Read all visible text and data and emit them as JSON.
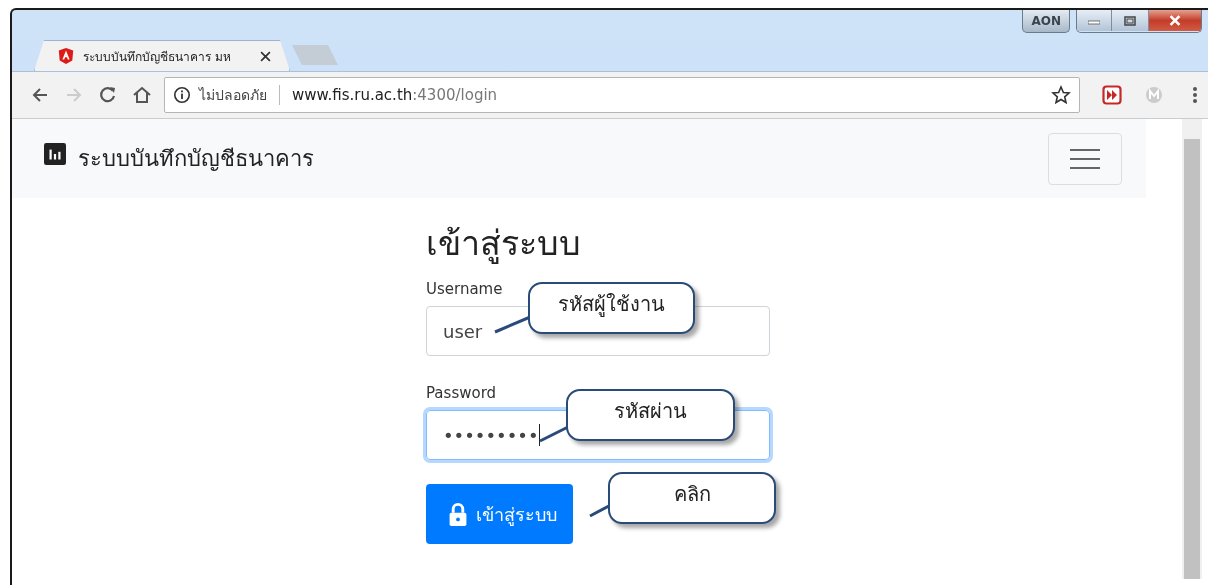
{
  "window": {
    "badge": "AON"
  },
  "tabs": [
    {
      "title": "ระบบบันทึกบัญชีธนาคาร มห",
      "selected": true
    }
  ],
  "address_bar": {
    "security_label": "ไม่ปลอดภัย",
    "host": "www.fis.ru.ac.th",
    "path": ":4300/login"
  },
  "navbar": {
    "brand": "ระบบบันทึกบัญชีธนาคาร"
  },
  "form": {
    "heading": "เข้าสู่ระบบ",
    "fields": [
      {
        "label": "Username",
        "value": "user",
        "focused": false
      },
      {
        "label": "Password",
        "value": "•••••••••",
        "focused": true
      }
    ],
    "submit": "เข้าสู่ระบบ"
  },
  "callouts": [
    {
      "text": "รหัสผู้ใช้งาน"
    },
    {
      "text": "รหัสผ่าน"
    },
    {
      "text": "คลิก"
    }
  ]
}
